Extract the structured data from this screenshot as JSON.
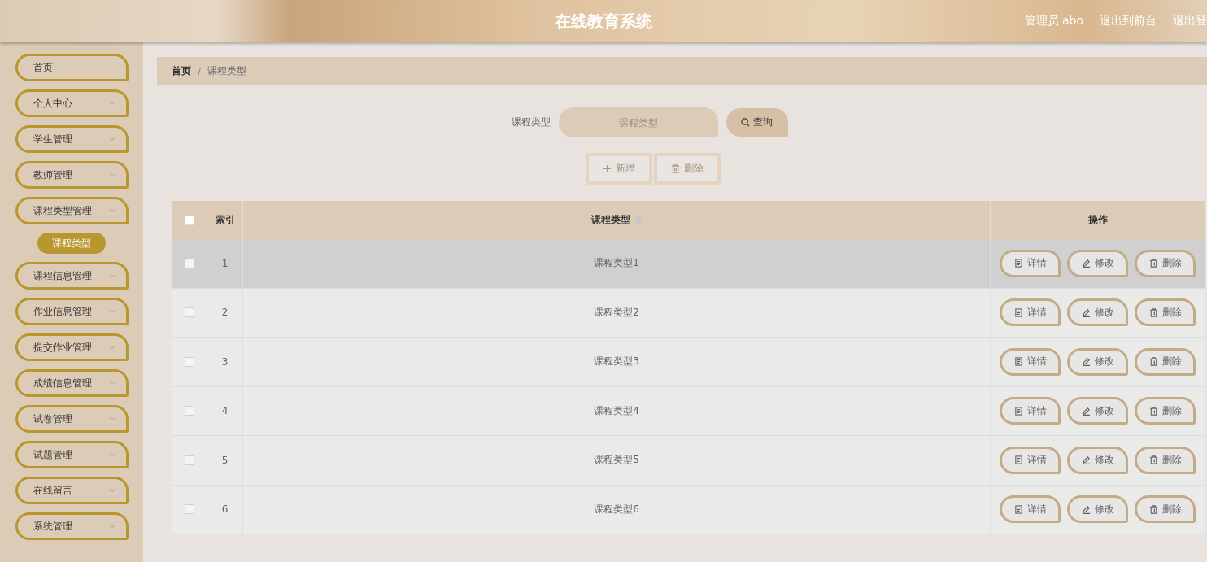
{
  "header": {
    "title": "在线教育系统",
    "user": "管理员 abo",
    "links": [
      "退出到前台",
      "退出登"
    ]
  },
  "sidebar": {
    "items": [
      {
        "label": "首页",
        "expandable": false
      },
      {
        "label": "个人中心",
        "expandable": true
      },
      {
        "label": "学生管理",
        "expandable": true
      },
      {
        "label": "教师管理",
        "expandable": true
      },
      {
        "label": "课程类型管理",
        "expandable": true,
        "children": [
          {
            "label": "课程类型",
            "selected": true
          }
        ]
      },
      {
        "label": "课程信息管理",
        "expandable": true
      },
      {
        "label": "作业信息管理",
        "expandable": true
      },
      {
        "label": "提交作业管理",
        "expandable": true
      },
      {
        "label": "成绩信息管理",
        "expandable": true
      },
      {
        "label": "试卷管理",
        "expandable": true
      },
      {
        "label": "试题管理",
        "expandable": true
      },
      {
        "label": "在线留言",
        "expandable": true
      },
      {
        "label": "系统管理",
        "expandable": true
      }
    ]
  },
  "breadcrumb": [
    "首页",
    "/",
    "课程类型"
  ],
  "search": {
    "label": "课程类型",
    "placeholder": "课程类型",
    "button": "查询"
  },
  "actions": [
    "新增",
    "删除"
  ],
  "table": {
    "columns": [
      "索引",
      "课程类型",
      "操作"
    ],
    "all_checked": false,
    "rows": [
      {
        "index": "1",
        "type": "课程类型1",
        "checked": false,
        "highlighted": true,
        "buttons": [
          "详情",
          "修改",
          "删除"
        ]
      },
      {
        "index": "2",
        "type": "课程类型2",
        "checked": false,
        "highlighted": false,
        "buttons": [
          "详情",
          "修改",
          "删除"
        ]
      },
      {
        "index": "3",
        "type": "课程类型3",
        "checked": false,
        "highlighted": false,
        "buttons": [
          "详情",
          "修改",
          "删除"
        ]
      },
      {
        "index": "4",
        "type": "课程类型4",
        "checked": false,
        "highlighted": false,
        "buttons": [
          "详情",
          "修改",
          "删除"
        ]
      },
      {
        "index": "5",
        "type": "课程类型5",
        "checked": false,
        "highlighted": false,
        "buttons": [
          "详情",
          "修改",
          "删除"
        ]
      },
      {
        "index": "6",
        "type": "课程类型6",
        "checked": false,
        "highlighted": false,
        "buttons": [
          "详情",
          "修改",
          "删除"
        ]
      }
    ]
  }
}
